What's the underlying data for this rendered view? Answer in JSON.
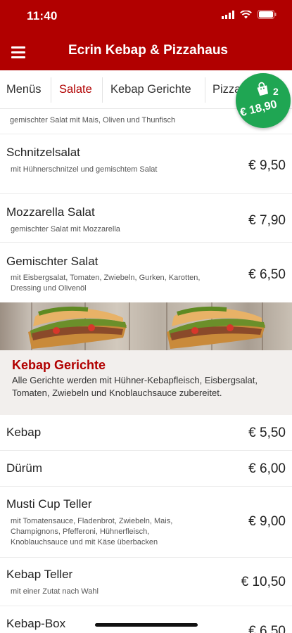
{
  "status_bar": {
    "time": "11:40"
  },
  "app_bar": {
    "title": "Ecrin Kebap & Pizzahaus"
  },
  "tabs": [
    {
      "label": "Menüs",
      "active": false
    },
    {
      "label": "Salate",
      "active": true
    },
    {
      "label": "Kebap Gerichte",
      "active": false
    },
    {
      "label": "Pizza",
      "active": false
    }
  ],
  "cart": {
    "count": "2",
    "total": "€ 18,90",
    "color": "#1fa653"
  },
  "partial_item": {
    "description": "gemischter Salat mit Mais, Oliven und Thunfisch"
  },
  "salads": [
    {
      "name": "Schnitzelsalat",
      "description": "mit Hühnerschnitzel und gemischtem Salat",
      "price": "€ 9,50"
    },
    {
      "name": "Mozzarella Salat",
      "description": "gemischter Salat mit Mozzarella",
      "price": "€ 7,90"
    },
    {
      "name": "Gemischter Salat",
      "description": "mit Eisbergsalat, Tomaten, Zwiebeln, Gurken, Karotten, Dressing und Olivenöl",
      "price": "€ 6,50"
    }
  ],
  "section": {
    "title": "Kebap Gerichte",
    "text": "Alle Gerichte werden mit Hühner-Kebapfleisch, Eisbergsalat, Tomaten, Zwiebeln und Knoblauchsauce zubereitet."
  },
  "kebap_items": [
    {
      "name": "Kebap",
      "description": "",
      "price": "€ 5,50"
    },
    {
      "name": "Dürüm",
      "description": "",
      "price": "€ 6,00"
    },
    {
      "name": "Musti Cup Teller",
      "description": "mit Tomatensauce, Fladenbrot, Zwiebeln, Mais, Champignons, Pfefferoni, Hühnerfleisch, Knoblauchsauce und mit Käse überbacken",
      "price": "€ 9,00"
    },
    {
      "name": "Kebap Teller",
      "description": "mit einer Zutat nach Wahl",
      "price": "€ 10,50"
    },
    {
      "name": "Kebap-Box",
      "description": "",
      "price": "€ 6,50"
    }
  ],
  "colors": {
    "brand_red": "#b10000",
    "accent_green": "#1fa653"
  }
}
